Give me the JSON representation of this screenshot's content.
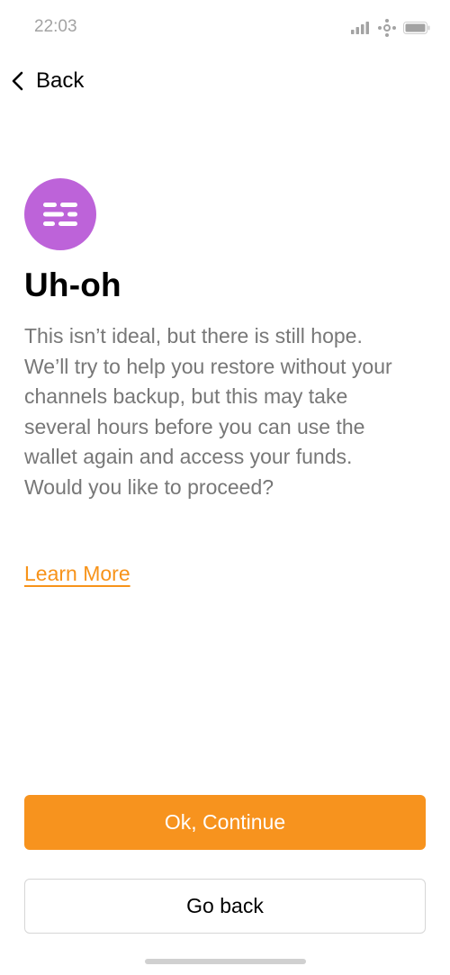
{
  "status_bar": {
    "time": "22:03",
    "icons": [
      "signal-bars-icon",
      "network-icon",
      "battery-icon"
    ],
    "color": "#a3a3a3"
  },
  "nav": {
    "back_label": "Back",
    "back_icon": "chevron-left-icon"
  },
  "content": {
    "icon": "channels-backup-icon",
    "icon_bg_color": "#bd63d9",
    "title": "Uh-oh",
    "body": "This isn’t ideal, but there is still hope. We’ll try to help you restore without your channels backup, but this may take several hours before you can use the wallet again and access your funds. Would you like to proceed?",
    "learn_more": "Learn More",
    "link_color": "#f7931a"
  },
  "actions": {
    "primary_label": "Ok, Continue",
    "primary_color": "#f7931e",
    "secondary_label": "Go back"
  }
}
